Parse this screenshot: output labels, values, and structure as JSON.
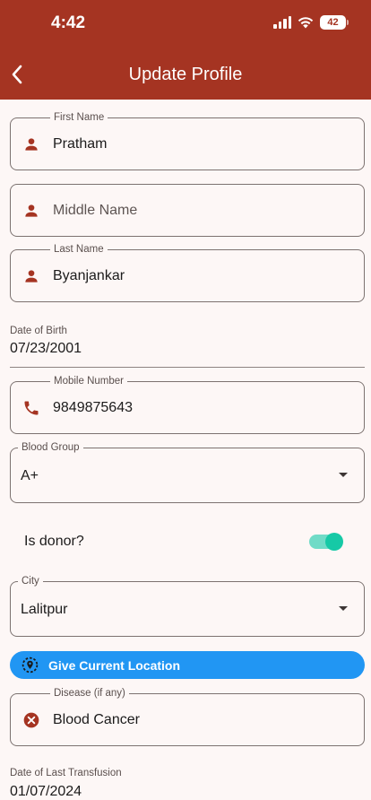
{
  "status_bar": {
    "time": "4:42",
    "battery": "42"
  },
  "app_bar": {
    "title": "Update Profile",
    "back_icon": "chevron-left-icon"
  },
  "colors": {
    "primary": "#a53422",
    "accent": "#2196f3",
    "switch_on": "#16c9a6"
  },
  "form": {
    "first_name": {
      "label": "First Name",
      "value": "Pratham",
      "icon": "person-icon"
    },
    "middle_name": {
      "placeholder": "Middle Name",
      "icon": "person-icon"
    },
    "last_name": {
      "label": "Last Name",
      "value": "Byanjankar",
      "icon": "person-icon"
    },
    "dob": {
      "label": "Date of Birth",
      "value": "07/23/2001"
    },
    "mobile": {
      "label": "Mobile Number",
      "value": "9849875643",
      "icon": "phone-icon"
    },
    "blood_group": {
      "label": "Blood Group",
      "value": "A+"
    },
    "is_donor": {
      "label": "Is donor?",
      "on": true
    },
    "city": {
      "label": "City",
      "value": "Lalitpur"
    },
    "location_button": {
      "label": "Give Current Location",
      "icon": "location-target-icon"
    },
    "disease": {
      "label": "Disease (if any)",
      "value": "Blood Cancer",
      "icon": "cancel-circle-icon"
    },
    "last_transfusion": {
      "label": "Date of Last Transfusion",
      "value": "01/07/2024"
    }
  }
}
